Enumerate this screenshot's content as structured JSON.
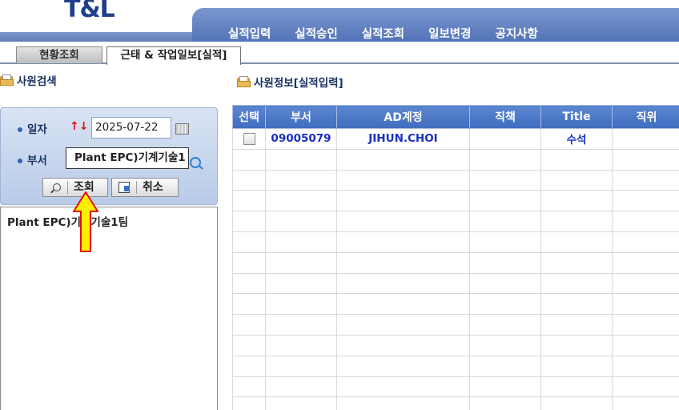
{
  "app": {
    "logo": "T&L"
  },
  "nav": {
    "items": [
      "실적입력",
      "실적승인",
      "실적조회",
      "일보변경",
      "공지사항"
    ]
  },
  "tabs": [
    {
      "label": "현황조회"
    },
    {
      "label": "근태 & 작업일보[실적]"
    }
  ],
  "left_panel": {
    "title": "사원검색",
    "date_label": "일자",
    "date_arrows": "↑↓",
    "date_value": "2025-07-22",
    "dept_label": "부서",
    "dept_value": "Plant EPC)기계기술1",
    "search_button": "조회",
    "cancel_button": "취소",
    "tree_items": [
      "Plant EPC)기계기술1팀"
    ]
  },
  "right_panel": {
    "title": "사원정보[실적입력]",
    "columns": [
      "선택",
      "부서",
      "AD계정",
      "직책",
      "Title",
      "직위"
    ],
    "rows": [
      {
        "dept": "09005079",
        "ad": "JIHUN.CHOI",
        "position": "",
        "title": "수석",
        "rank": ""
      }
    ]
  },
  "colors": {
    "accent": "#4f73b9",
    "header_blue": "#4a75c4",
    "link_blue": "#1a2fc4",
    "arrow_red": "#e01010",
    "highlight": "#ffee00"
  }
}
